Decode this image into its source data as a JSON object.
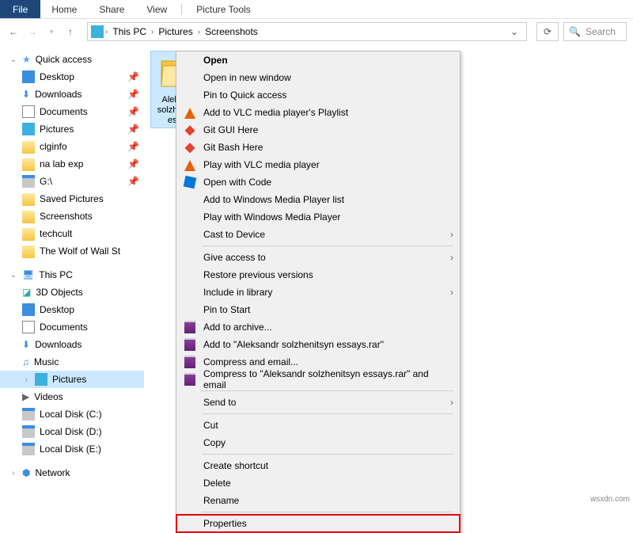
{
  "ribbon": {
    "file": "File",
    "home": "Home",
    "share": "Share",
    "view": "View",
    "picture_tools": "Picture Tools"
  },
  "breadcrumb": {
    "seg1": "This PC",
    "seg2": "Pictures",
    "seg3": "Screenshots"
  },
  "search": {
    "placeholder": "Search"
  },
  "sidebar": {
    "quick_access": "Quick access",
    "qa_items": [
      {
        "label": "Desktop"
      },
      {
        "label": "Downloads"
      },
      {
        "label": "Documents"
      },
      {
        "label": "Pictures"
      },
      {
        "label": "clginfo"
      },
      {
        "label": "na lab exp"
      },
      {
        "label": "G:\\"
      },
      {
        "label": "Saved Pictures"
      },
      {
        "label": "Screenshots"
      },
      {
        "label": "techcult"
      },
      {
        "label": "The Wolf of Wall St"
      }
    ],
    "this_pc": "This PC",
    "pc_items": [
      {
        "label": "3D Objects"
      },
      {
        "label": "Desktop"
      },
      {
        "label": "Documents"
      },
      {
        "label": "Downloads"
      },
      {
        "label": "Music"
      },
      {
        "label": "Pictures"
      },
      {
        "label": "Videos"
      },
      {
        "label": "Local Disk (C:)"
      },
      {
        "label": "Local Disk (D:)"
      },
      {
        "label": "Local Disk (E:)"
      }
    ],
    "network": "Network"
  },
  "content": {
    "folder_name": "Aleksandr solzhenitsyn essays"
  },
  "context_menu": {
    "open": "Open",
    "open_new_window": "Open in new window",
    "pin_quick_access": "Pin to Quick access",
    "add_vlc_playlist": "Add to VLC media player's Playlist",
    "git_gui": "Git GUI Here",
    "git_bash": "Git Bash Here",
    "play_vlc": "Play with VLC media player",
    "open_code": "Open with Code",
    "add_wmp_list": "Add to Windows Media Player list",
    "play_wmp": "Play with Windows Media Player",
    "cast": "Cast to Device",
    "give_access": "Give access to",
    "restore": "Restore previous versions",
    "include_library": "Include in library",
    "pin_start": "Pin to Start",
    "add_archive": "Add to archive...",
    "add_rar": "Add to \"Aleksandr solzhenitsyn essays.rar\"",
    "compress_email": "Compress and email...",
    "compress_rar_email": "Compress to \"Aleksandr solzhenitsyn essays.rar\" and email",
    "send_to": "Send to",
    "cut": "Cut",
    "copy": "Copy",
    "create_shortcut": "Create shortcut",
    "delete": "Delete",
    "rename": "Rename",
    "properties": "Properties"
  },
  "watermark": "wsxdn.com"
}
